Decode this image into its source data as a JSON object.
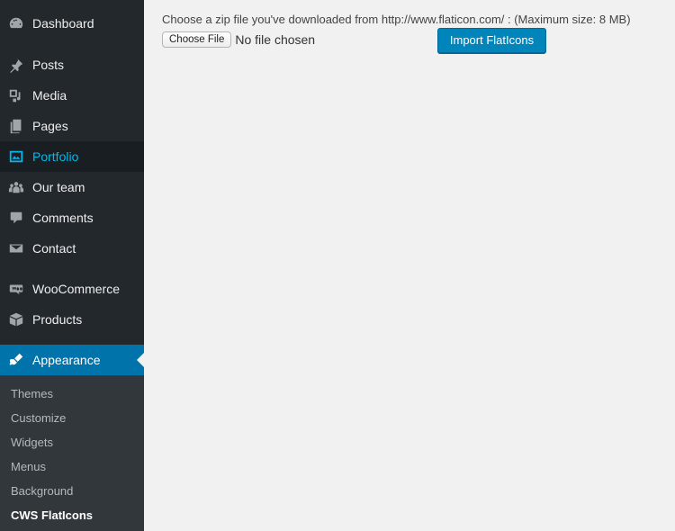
{
  "sidebar": {
    "items": [
      {
        "label": "Dashboard",
        "icon": "dashboard-icon"
      },
      {
        "label": "Posts",
        "icon": "pushpin-icon"
      },
      {
        "label": "Media",
        "icon": "media-icon"
      },
      {
        "label": "Pages",
        "icon": "pages-icon"
      },
      {
        "label": "Portfolio",
        "icon": "portfolio-icon"
      },
      {
        "label": "Our team",
        "icon": "team-icon"
      },
      {
        "label": "Comments",
        "icon": "comment-icon"
      },
      {
        "label": "Contact",
        "icon": "envelope-icon"
      },
      {
        "label": "WooCommerce",
        "icon": "woocommerce-icon"
      },
      {
        "label": "Products",
        "icon": "box-icon"
      },
      {
        "label": "Appearance",
        "icon": "paintbrush-icon"
      }
    ],
    "submenu": [
      "Themes",
      "Customize",
      "Widgets",
      "Menus",
      "Background",
      "CWS FlatIcons"
    ]
  },
  "main": {
    "instructions": "Choose a zip file you've downloaded from http://www.flaticon.com/ : (Maximum size: 8 MB)",
    "choose_file_label": "Choose File",
    "no_file_text": "No file chosen",
    "import_button_label": "Import FlatIcons"
  },
  "colors": {
    "sidebar_bg": "#23282d",
    "submenu_bg": "#32373c",
    "active_bg": "#0073aa",
    "highlight_text": "#00b9eb",
    "content_bg": "#f1f1f1",
    "button_bg": "#0085ba"
  }
}
